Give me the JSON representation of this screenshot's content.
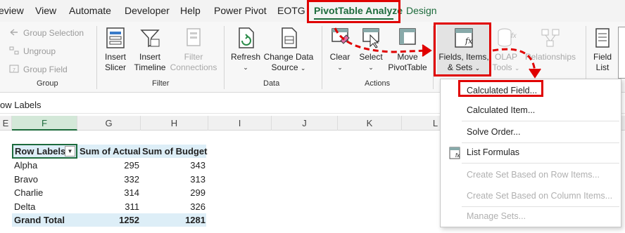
{
  "tabs": [
    {
      "label": "eview"
    },
    {
      "label": "View"
    },
    {
      "label": "Automate"
    },
    {
      "label": "Developer"
    },
    {
      "label": "Help"
    },
    {
      "label": "Power Pivot"
    },
    {
      "label": "EOTG"
    },
    {
      "label": "PivotTable Analyze"
    },
    {
      "label": "Design"
    }
  ],
  "ribbon": {
    "group_small": [
      "Group Selection",
      "Ungroup",
      "Group Field"
    ],
    "group_label": "Group",
    "insert_slicer": [
      "Insert",
      "Slicer"
    ],
    "insert_timeline": [
      "Insert",
      "Timeline"
    ],
    "filter_connections": [
      "Filter",
      "Connections"
    ],
    "filter_label": "Filter",
    "refresh": "Refresh",
    "change_data_source": [
      "Change Data",
      "Source"
    ],
    "data_label": "Data",
    "clear": "Clear",
    "select": "Select",
    "move_pivottable": [
      "Move",
      "PivotTable"
    ],
    "actions_label": "Actions",
    "fields_items_sets": [
      "Fields, Items,",
      "& Sets"
    ],
    "olap_tools": [
      "OLAP",
      "Tools"
    ],
    "relationships": "Relationships",
    "field_list": [
      "Field",
      "List"
    ]
  },
  "namebar": {
    "text": "ow Labels"
  },
  "columns": [
    "E",
    "F",
    "G",
    "H",
    "I",
    "J",
    "K",
    "L"
  ],
  "pivot": {
    "headers": [
      "Row Labels",
      "Sum of Actual",
      "Sum of Budget"
    ],
    "rows": [
      {
        "label": "Alpha",
        "actual": "295",
        "budget": "343"
      },
      {
        "label": "Bravo",
        "actual": "332",
        "budget": "313"
      },
      {
        "label": "Charlie",
        "actual": "314",
        "budget": "299"
      },
      {
        "label": "Delta",
        "actual": "311",
        "budget": "326"
      }
    ],
    "total": {
      "label": "Grand Total",
      "actual": "1252",
      "budget": "1281"
    }
  },
  "menu": {
    "items": [
      {
        "label": "Calculated Field..."
      },
      {
        "label": "Calculated Item..."
      },
      {
        "label": "Solve Order..."
      },
      {
        "label": "List Formulas"
      },
      {
        "label": "Create Set Based on Row Items..."
      },
      {
        "label": "Create Set Based on Column Items..."
      },
      {
        "label": "Manage Sets..."
      }
    ]
  },
  "colors": {
    "accent": "#1d6b3c",
    "highlight": "#e00000",
    "pivot_header": "#ddeef7"
  }
}
